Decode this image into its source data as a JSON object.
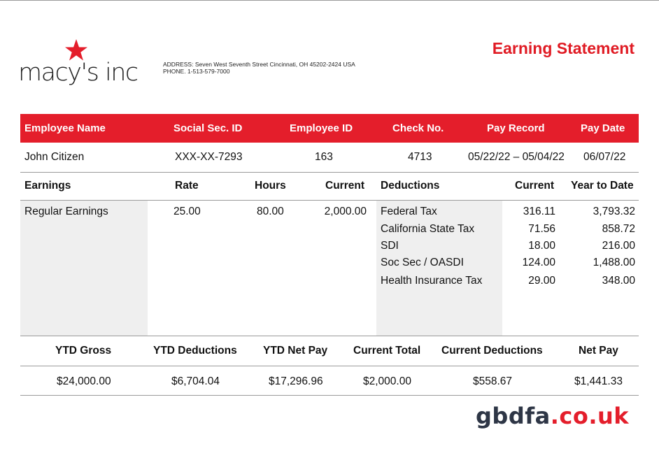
{
  "header": {
    "logo_text": "macy's inc",
    "address_line": "ADDRESS: Seven West Seventh Street Cincinnati, OH 45202-2424 USA",
    "phone_line": "PHONE. 1-513-579-7000",
    "title": "Earning Statement",
    "brand_color": "#e41e2b"
  },
  "employee_table": {
    "headers": {
      "name": "Employee Name",
      "ssn": "Social Sec. ID",
      "employee_id": "Employee ID",
      "check_no": "Check No.",
      "pay_record": "Pay Record",
      "pay_date": "Pay Date"
    },
    "row": {
      "name": "John Citizen",
      "ssn": "XXX-XX-7293",
      "employee_id": "163",
      "check_no": "4713",
      "pay_record": "05/22/22 – 05/04/22",
      "pay_date": "06/07/22"
    }
  },
  "earnings": {
    "headers": {
      "earnings": "Earnings",
      "rate": "Rate",
      "hours": "Hours",
      "current": "Current"
    },
    "rows": [
      {
        "label": "Regular Earnings",
        "rate": "25.00",
        "hours": "80.00",
        "current": "2,000.00"
      }
    ]
  },
  "deductions": {
    "headers": {
      "deductions": "Deductions",
      "current": "Current",
      "ytd": "Year to Date"
    },
    "rows": [
      {
        "label": "Federal Tax",
        "current": "316.11",
        "ytd": "3,793.32"
      },
      {
        "label": "California State Tax",
        "current": "71.56",
        "ytd": "858.72"
      },
      {
        "label": "SDI",
        "current": "18.00",
        "ytd": "216.00"
      },
      {
        "label": "Soc Sec / OASDI",
        "current": "124.00",
        "ytd": "1,488.00"
      },
      {
        "label": "Health Insurance Tax",
        "current": "29.00",
        "ytd": "348.00"
      }
    ]
  },
  "summary": {
    "headers": {
      "ytd_gross": "YTD Gross",
      "ytd_deductions": "YTD Deductions",
      "ytd_net_pay": "YTD Net Pay",
      "current_total": "Current Total",
      "current_deductions": "Current Deductions",
      "net_pay": "Net Pay"
    },
    "values": {
      "ytd_gross": "$24,000.00",
      "ytd_deductions": "$6,704.04",
      "ytd_net_pay": "$17,296.96",
      "current_total": "$2,000.00",
      "current_deductions": "$558.67",
      "net_pay": "$1,441.33"
    }
  },
  "watermark": {
    "part1": "gbdfa",
    "part2": ".co.uk"
  }
}
